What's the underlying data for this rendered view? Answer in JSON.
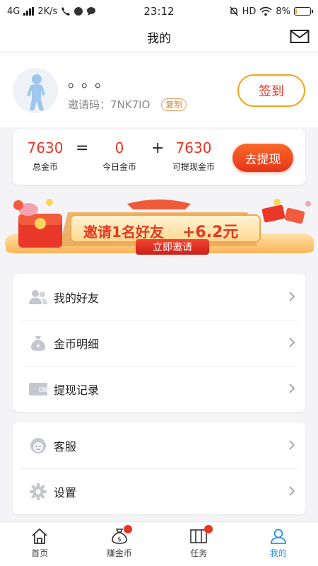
{
  "status_bar": {
    "network": "4G",
    "speed": "2K/s",
    "time": "23:12",
    "hd": "HD",
    "battery": "8%",
    "battery_level": 0.08
  },
  "header": {
    "title": "我的"
  },
  "profile": {
    "nickname": "。。。",
    "invite_label": "邀请码：7NK7IO",
    "copy_label": "复制",
    "checkin_label": "签到"
  },
  "coins": {
    "total_value": "7630",
    "total_label": "总金币",
    "equals": "=",
    "today_value": "0",
    "today_label": "今日金币",
    "plus": "+",
    "withdrawable_value": "7630",
    "withdrawable_label": "可提现金币",
    "withdraw_button": "去提现"
  },
  "banner": {
    "headline": "邀请1名好友",
    "reward": "+6.2元",
    "cta": "立即邀请"
  },
  "menu_group_1": [
    {
      "label": "我的好友",
      "icon": "friends-icon"
    },
    {
      "label": "金币明细",
      "icon": "money-bag-icon"
    },
    {
      "label": "提现记录",
      "icon": "wallet-icon"
    }
  ],
  "menu_group_2": [
    {
      "label": "客服",
      "icon": "customer-service-icon"
    },
    {
      "label": "设置",
      "icon": "settings-gear-icon"
    }
  ],
  "tabs": [
    {
      "label": "首页",
      "icon": "home-icon"
    },
    {
      "label": "赚金币",
      "icon": "earn-coins-icon"
    },
    {
      "label": "任务",
      "icon": "tasks-icon"
    },
    {
      "label": "我的",
      "icon": "me-icon"
    }
  ],
  "colors": {
    "accent_red": "#e53627",
    "accent_blue": "#2c8ef0",
    "gold": "#f1a51b"
  }
}
